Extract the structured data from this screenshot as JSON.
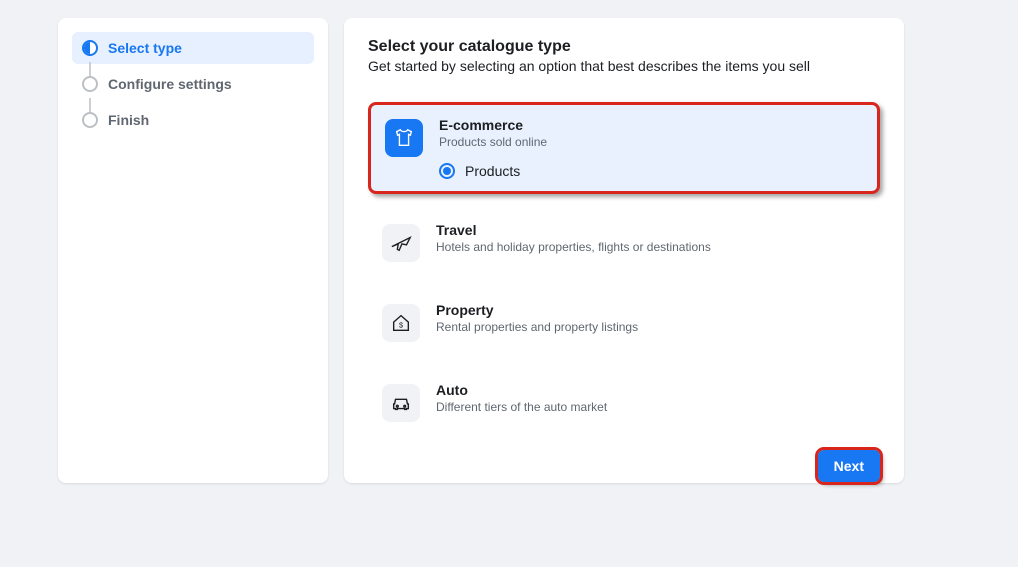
{
  "sidebar": {
    "steps": [
      {
        "label": "Select type",
        "active": true
      },
      {
        "label": "Configure settings",
        "active": false
      },
      {
        "label": "Finish",
        "active": false
      }
    ]
  },
  "main": {
    "title": "Select your catalogue type",
    "subtitle": "Get started by selecting an option that best describes the items you sell",
    "options": [
      {
        "title": "E-commerce",
        "desc": "Products sold online",
        "selected": true,
        "icon": "shirt-icon",
        "radio": {
          "label": "Products",
          "checked": true
        }
      },
      {
        "title": "Travel",
        "desc": "Hotels and holiday properties, flights or destinations",
        "selected": false,
        "icon": "plane-icon"
      },
      {
        "title": "Property",
        "desc": "Rental properties and property listings",
        "selected": false,
        "icon": "house-icon"
      },
      {
        "title": "Auto",
        "desc": "Different tiers of the auto market",
        "selected": false,
        "icon": "car-icon"
      }
    ],
    "next_label": "Next"
  }
}
